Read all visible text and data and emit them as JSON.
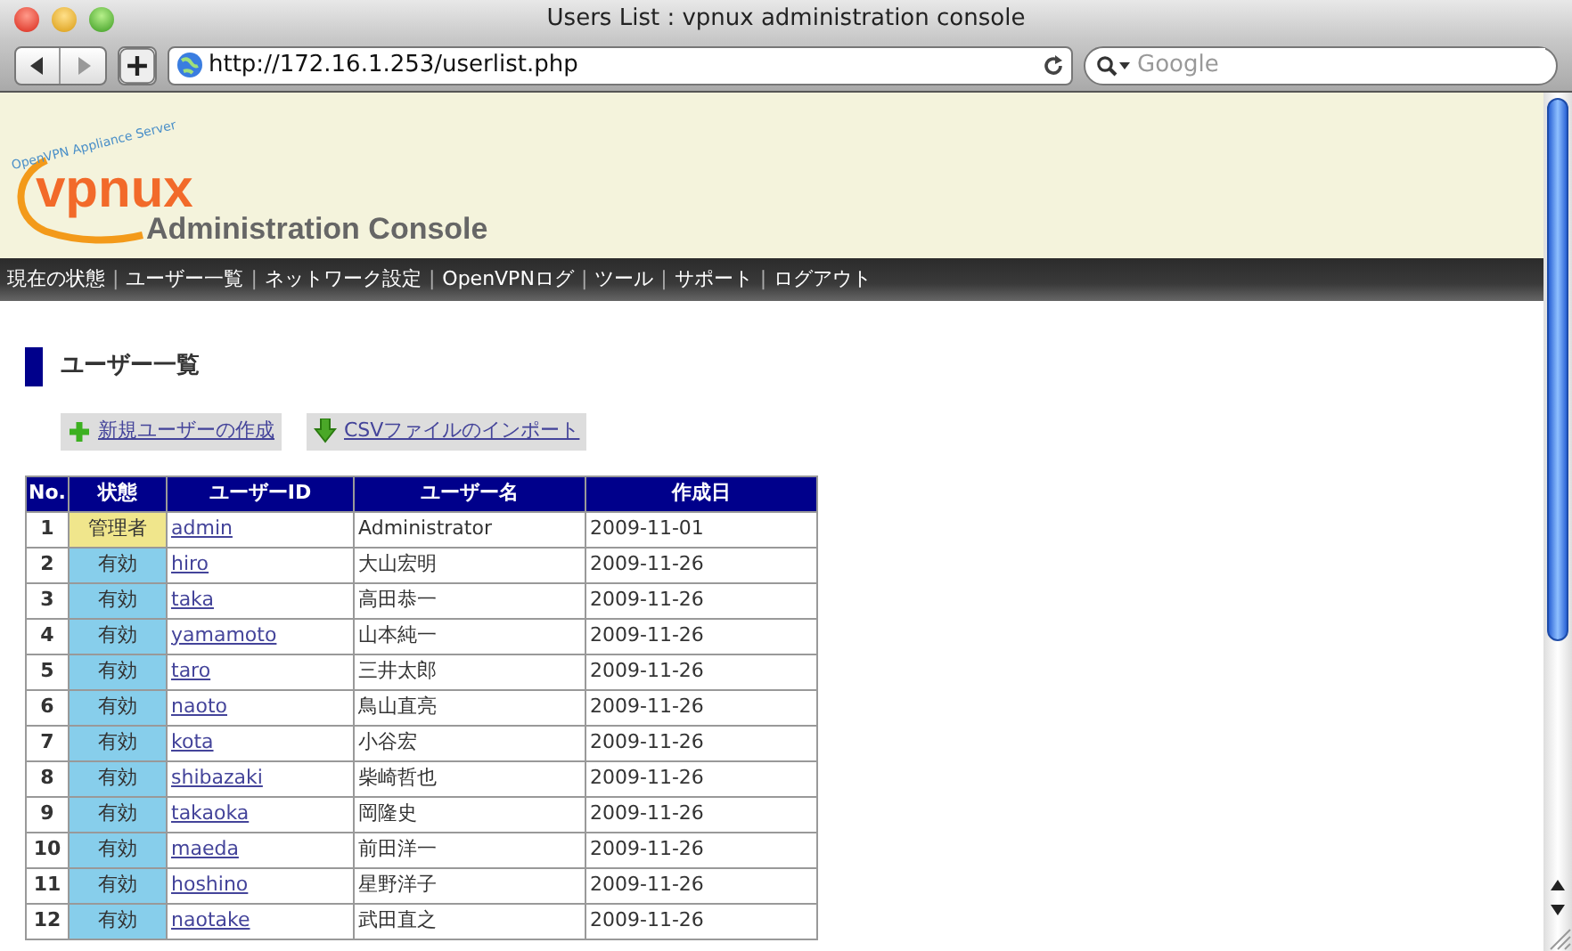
{
  "window": {
    "title": "Users List : vpnux administration console"
  },
  "toolbar": {
    "url": "http://172.16.1.253/userlist.php",
    "search_placeholder": "Google"
  },
  "header": {
    "logo_tagline": "OpenVPN Appliance Server",
    "logo": "vpnux",
    "subtitle": "Administration Console"
  },
  "nav": [
    "現在の状態",
    "ユーザー一覧",
    "ネットワーク設定",
    "OpenVPNログ",
    "ツール",
    "サポート",
    "ログアウト"
  ],
  "nav_separator": "|",
  "heading": "ユーザー一覧",
  "actions": [
    {
      "label": "新規ユーザーの作成",
      "kind": "add"
    },
    {
      "label": "CSVファイルのインポート",
      "kind": "import"
    }
  ],
  "table": {
    "columns": [
      "No.",
      "状態",
      "ユーザーID",
      "ユーザー名",
      "作成日"
    ],
    "rows": [
      {
        "no": "1",
        "status": "管理者",
        "color": "#f0e68c",
        "id": "admin",
        "name": "Administrator",
        "date": "2009-11-01"
      },
      {
        "no": "2",
        "status": "有効",
        "color": "#87ceeb",
        "id": "hiro",
        "name": "大山宏明",
        "date": "2009-11-26"
      },
      {
        "no": "3",
        "status": "有効",
        "color": "#87ceeb",
        "id": "taka",
        "name": "高田恭一",
        "date": "2009-11-26"
      },
      {
        "no": "4",
        "status": "有効",
        "color": "#87ceeb",
        "id": "yamamoto",
        "name": "山本純一",
        "date": "2009-11-26"
      },
      {
        "no": "5",
        "status": "有効",
        "color": "#87ceeb",
        "id": "taro",
        "name": "三井太郎",
        "date": "2009-11-26"
      },
      {
        "no": "6",
        "status": "有効",
        "color": "#87ceeb",
        "id": "naoto",
        "name": "鳥山直亮",
        "date": "2009-11-26"
      },
      {
        "no": "7",
        "status": "有効",
        "color": "#87ceeb",
        "id": "kota",
        "name": "小谷宏",
        "date": "2009-11-26"
      },
      {
        "no": "8",
        "status": "有効",
        "color": "#87ceeb",
        "id": "shibazaki",
        "name": "柴崎哲也",
        "date": "2009-11-26"
      },
      {
        "no": "9",
        "status": "有効",
        "color": "#87ceeb",
        "id": "takaoka",
        "name": "岡隆史",
        "date": "2009-11-26"
      },
      {
        "no": "10",
        "status": "有効",
        "color": "#87ceeb",
        "id": "maeda",
        "name": "前田洋一",
        "date": "2009-11-26"
      },
      {
        "no": "11",
        "status": "有効",
        "color": "#87ceeb",
        "id": "hoshino",
        "name": "星野洋子",
        "date": "2009-11-26"
      },
      {
        "no": "12",
        "status": "有効",
        "color": "#87ceeb",
        "id": "naotake",
        "name": "武田直之",
        "date": "2009-11-26"
      }
    ]
  }
}
